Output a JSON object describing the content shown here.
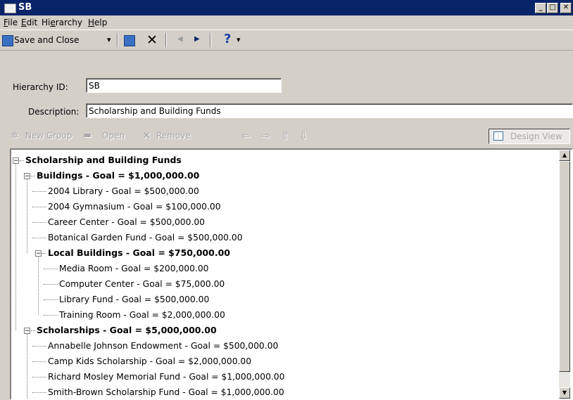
{
  "window": {
    "title": "SB",
    "minimize": "_",
    "maximize": "□",
    "close": "✕"
  },
  "menu": [
    {
      "label": "File",
      "accel": "F",
      "rest": "ile"
    },
    {
      "label": "Edit",
      "accel": "E",
      "rest": "dit"
    },
    {
      "label": "Hierarchy",
      "accel": "",
      "rest": ""
    },
    {
      "label": "Help",
      "accel": "H",
      "rest": "elp"
    }
  ],
  "menu_hierarchy": {
    "pre": "Hi",
    "accel": "e",
    "post": "rarchy"
  },
  "toolbar": {
    "save_close_label": "Save and Close",
    "dropdown_arrow": "▾",
    "delete_glyph": "✕",
    "prev_glyph": "◀",
    "next_glyph": "▶",
    "help_glyph": "?"
  },
  "form": {
    "hierarchy_id_label": "Hierarchy ID:",
    "hierarchy_id_value": "SB",
    "description_label": "Description:",
    "description_value": "Scholarship and Building Funds"
  },
  "group_toolbar": {
    "new_group": "New Group",
    "open": "Open",
    "remove": "Remove",
    "left": "⇦",
    "right": "⇨",
    "up": "⇧",
    "down": "⇩",
    "design_view": "Design View"
  },
  "tree": [
    {
      "text": "Scholarship and Building Funds",
      "bold": true
    },
    {
      "text": "Buildings  -  Goal = $1,000,000.00",
      "bold": true
    },
    {
      "text": "2004 Library - Goal = $500,000.00",
      "bold": false
    },
    {
      "text": "2004 Gymnasium  - Goal = $100,000.00",
      "bold": false
    },
    {
      "text": "Career Center  - Goal = $500,000.00",
      "bold": false
    },
    {
      "text": "Botanical Garden Fund  - Goal = $500,000.00",
      "bold": false
    },
    {
      "text": "Local Buildings  -  Goal = $750,000.00",
      "bold": true
    },
    {
      "text": "Media Room - Goal = $200,000.00",
      "bold": false
    },
    {
      "text": "Computer Center  - Goal = $75,000.00",
      "bold": false
    },
    {
      "text": "Library Fund  -  Goal = $500,000.00",
      "bold": false
    },
    {
      "text": "Training Room  -  Goal = $2,000,000.00",
      "bold": false
    },
    {
      "text": "Scholarships  -  Goal = $5,000,000.00",
      "bold": true
    },
    {
      "text": "Annabelle Johnson Endowment  - Goal = $500,000.00",
      "bold": false
    },
    {
      "text": "Camp Kids Scholarship  -  Goal = $2,000,000.00",
      "bold": false
    },
    {
      "text": "Richard Mosley Memorial Fund  -  Goal = $1,000,000.00",
      "bold": false
    },
    {
      "text": "Smith-Brown Scholarship Fund  -  Goal = $1,000,000.00",
      "bold": false
    }
  ],
  "expander_glyph": "−"
}
